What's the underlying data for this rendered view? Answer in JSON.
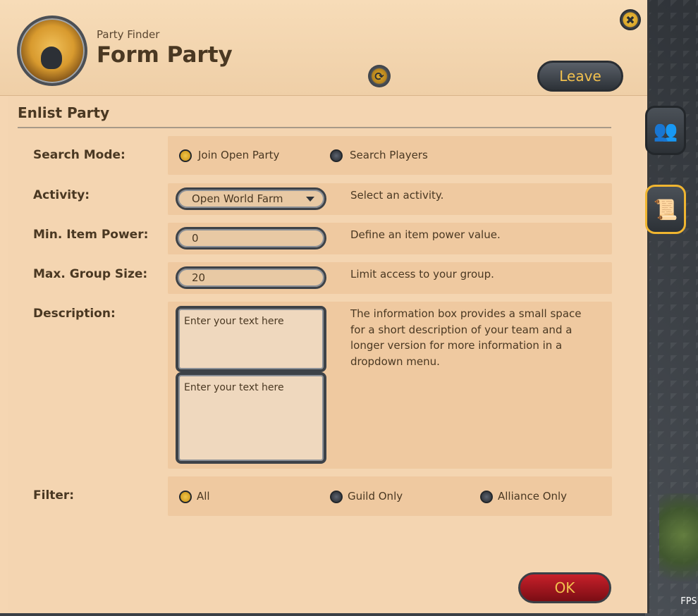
{
  "window": {
    "subtitle": "Party Finder",
    "title": "Form Party",
    "leave_label": "Leave",
    "close_glyph": "✖",
    "refresh_glyph": "⟳"
  },
  "side_tabs": [
    {
      "name": "members-tab",
      "icon": "party-members-icon",
      "glyph": "👥"
    },
    {
      "name": "scroll-tab",
      "icon": "scroll-icon",
      "glyph": "📜"
    }
  ],
  "section": {
    "title": "Enlist Party"
  },
  "search_mode": {
    "label": "Search Mode:",
    "options": [
      {
        "label": "Join Open Party",
        "checked": true
      },
      {
        "label": "Search Players",
        "checked": false
      }
    ]
  },
  "activity": {
    "label": "Activity:",
    "value": "Open World Farm",
    "hint": "Select an activity."
  },
  "min_item_power": {
    "label": "Min. Item Power:",
    "value": "0",
    "hint": "Define an item power value."
  },
  "max_group_size": {
    "label": "Max. Group Size:",
    "value": "20",
    "hint": "Limit access to your group."
  },
  "description": {
    "label": "Description:",
    "short_placeholder": "Enter your text here",
    "long_placeholder": "Enter your text here",
    "hint": "The information box provides a small space for a short description of your team and a longer version for more information in a dropdown menu."
  },
  "filter": {
    "label": "Filter:",
    "options": [
      {
        "label": "All",
        "checked": true
      },
      {
        "label": "Guild Only",
        "checked": false
      },
      {
        "label": "Alliance Only",
        "checked": false
      }
    ]
  },
  "ok_label": "OK",
  "fps_label": "FPS"
}
